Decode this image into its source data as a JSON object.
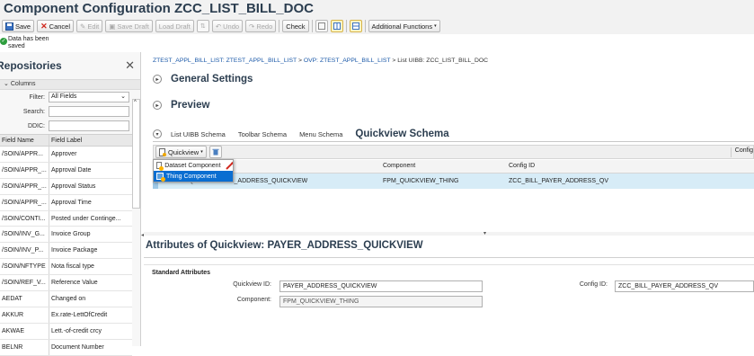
{
  "window": {
    "title": "Component Configuration ZCC_LIST_BILL_DOC"
  },
  "toolbar": {
    "save": "Save",
    "cancel": "Cancel",
    "edit": "Edit",
    "save_draft": "Save Draft",
    "load_draft": "Load Draft",
    "undo": "Undo",
    "redo": "Redo",
    "check": "Check",
    "additional_functions": "Additional Functions"
  },
  "message": {
    "line1": "Data has been",
    "line2": "saved"
  },
  "repositories": {
    "title": "Repositories",
    "columns_section": "Columns",
    "filter_label": "Filter:",
    "filter_value": "All Fields",
    "search_label": "Search:",
    "ddic_label": "DDIC:",
    "col_field_name": "Field Name",
    "col_field_label": "Field Label",
    "rows": [
      {
        "name": "/SOIN/APPR...",
        "label": "Approver"
      },
      {
        "name": "/SOIN/APPR_...",
        "label": "Approval Date"
      },
      {
        "name": "/SOIN/APPR_...",
        "label": "Approval Status"
      },
      {
        "name": "/SOIN/APPR_...",
        "label": "Approval Time"
      },
      {
        "name": "/SOIN/CONTI...",
        "label": "Posted under Continge..."
      },
      {
        "name": "/SOIN/INV_G...",
        "label": "Invoice Group"
      },
      {
        "name": "/SOIN/INV_P...",
        "label": "Invoice Package"
      },
      {
        "name": "/SOIN/NFTYPE",
        "label": "Nota fiscal type"
      },
      {
        "name": "/SOIN/REF_V...",
        "label": "Reference Value"
      },
      {
        "name": "AEDAT",
        "label": "Changed on"
      },
      {
        "name": "AKKUR",
        "label": "Ex.rate-LettOfCredit"
      },
      {
        "name": "AKWAE",
        "label": "Lett.-of-credit crcy"
      },
      {
        "name": "BELNR",
        "label": "Document Number"
      }
    ]
  },
  "breadcrumb": {
    "part1": "ZTEST_APPL_BILL_LIST: ZTEST_APPL_BILL_LIST",
    "part2": "OVP: ZTEST_APPL_BILL_LIST",
    "part3": "List UIBB: ZCC_LIST_BILL_DOC",
    "separator": ">"
  },
  "panels": {
    "general_settings": "General Settings",
    "preview": "Preview"
  },
  "tabs": {
    "list_uibb_schema": "List UIBB Schema",
    "toolbar_schema": "Toolbar Schema",
    "menu_schema": "Menu Schema",
    "quickview_schema": "Quickview Schema"
  },
  "quickview_toolbar": {
    "quickview_button": "Quickview",
    "config_header_right": "Config"
  },
  "quickview_menu": {
    "item1": "Dataset Component",
    "item2": "Thing Component"
  },
  "grid": {
    "col_component": "Component",
    "col_config_id": "Config ID",
    "row": {
      "name_fragment": "AYER_ADDRESS_QUICKVIEW",
      "name_overlay": "Quickvie",
      "component": "FPM_QUICKVIEW_THING",
      "config_id": "ZCC_BILL_PAYER_ADDRESS_QV"
    }
  },
  "attributes": {
    "title": "Attributes of Quickview: PAYER_ADDRESS_QUICKVIEW",
    "section": "Standard Attributes",
    "quickview_id_label": "Quickview ID:",
    "quickview_id_value": "PAYER_ADDRESS_QUICKVIEW",
    "component_label": "Component:",
    "component_value": "FPM_QUICKVIEW_THING",
    "config_id_label": "Config ID:",
    "config_id_value": "ZCC_BILL_PAYER_ADDRESS_QV"
  },
  "colors": {
    "accent_blue": "#0a6ed1",
    "title_text": "#2c3e50",
    "selected_row": "#d7ecf7",
    "success_green": "#2e9e3e",
    "red_cancel": "#d0271d"
  }
}
